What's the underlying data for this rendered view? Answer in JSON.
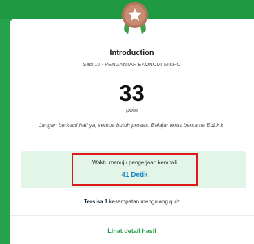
{
  "quiz": {
    "title": "Introduction",
    "subtitle": "Sesi 10 - PENGANTAR EKONOMI MIKRO",
    "score": "33",
    "score_unit": "poin",
    "motivation": "Jangan berkecil hati ya, semua butuh proses. Belajar terus bersama EdLink."
  },
  "retry": {
    "wait_label": "Waktu menuju pengerjaan kembali",
    "countdown": "41 Detik",
    "remaining_prefix": "Tersisa",
    "remaining_count": "1",
    "remaining_suffix": "kesempatan mengulang quiz"
  },
  "actions": {
    "detail_link": "Lihat detail hasil"
  },
  "badge": {
    "icon": "star-medal-icon"
  },
  "colors": {
    "background": "#25a24a",
    "accent_green": "#1f9a43",
    "countdown_blue": "#1e88c8",
    "panel_bg": "#e3f5e6",
    "highlight_red": "#e0191d",
    "medal_copper": "#b5765f"
  }
}
